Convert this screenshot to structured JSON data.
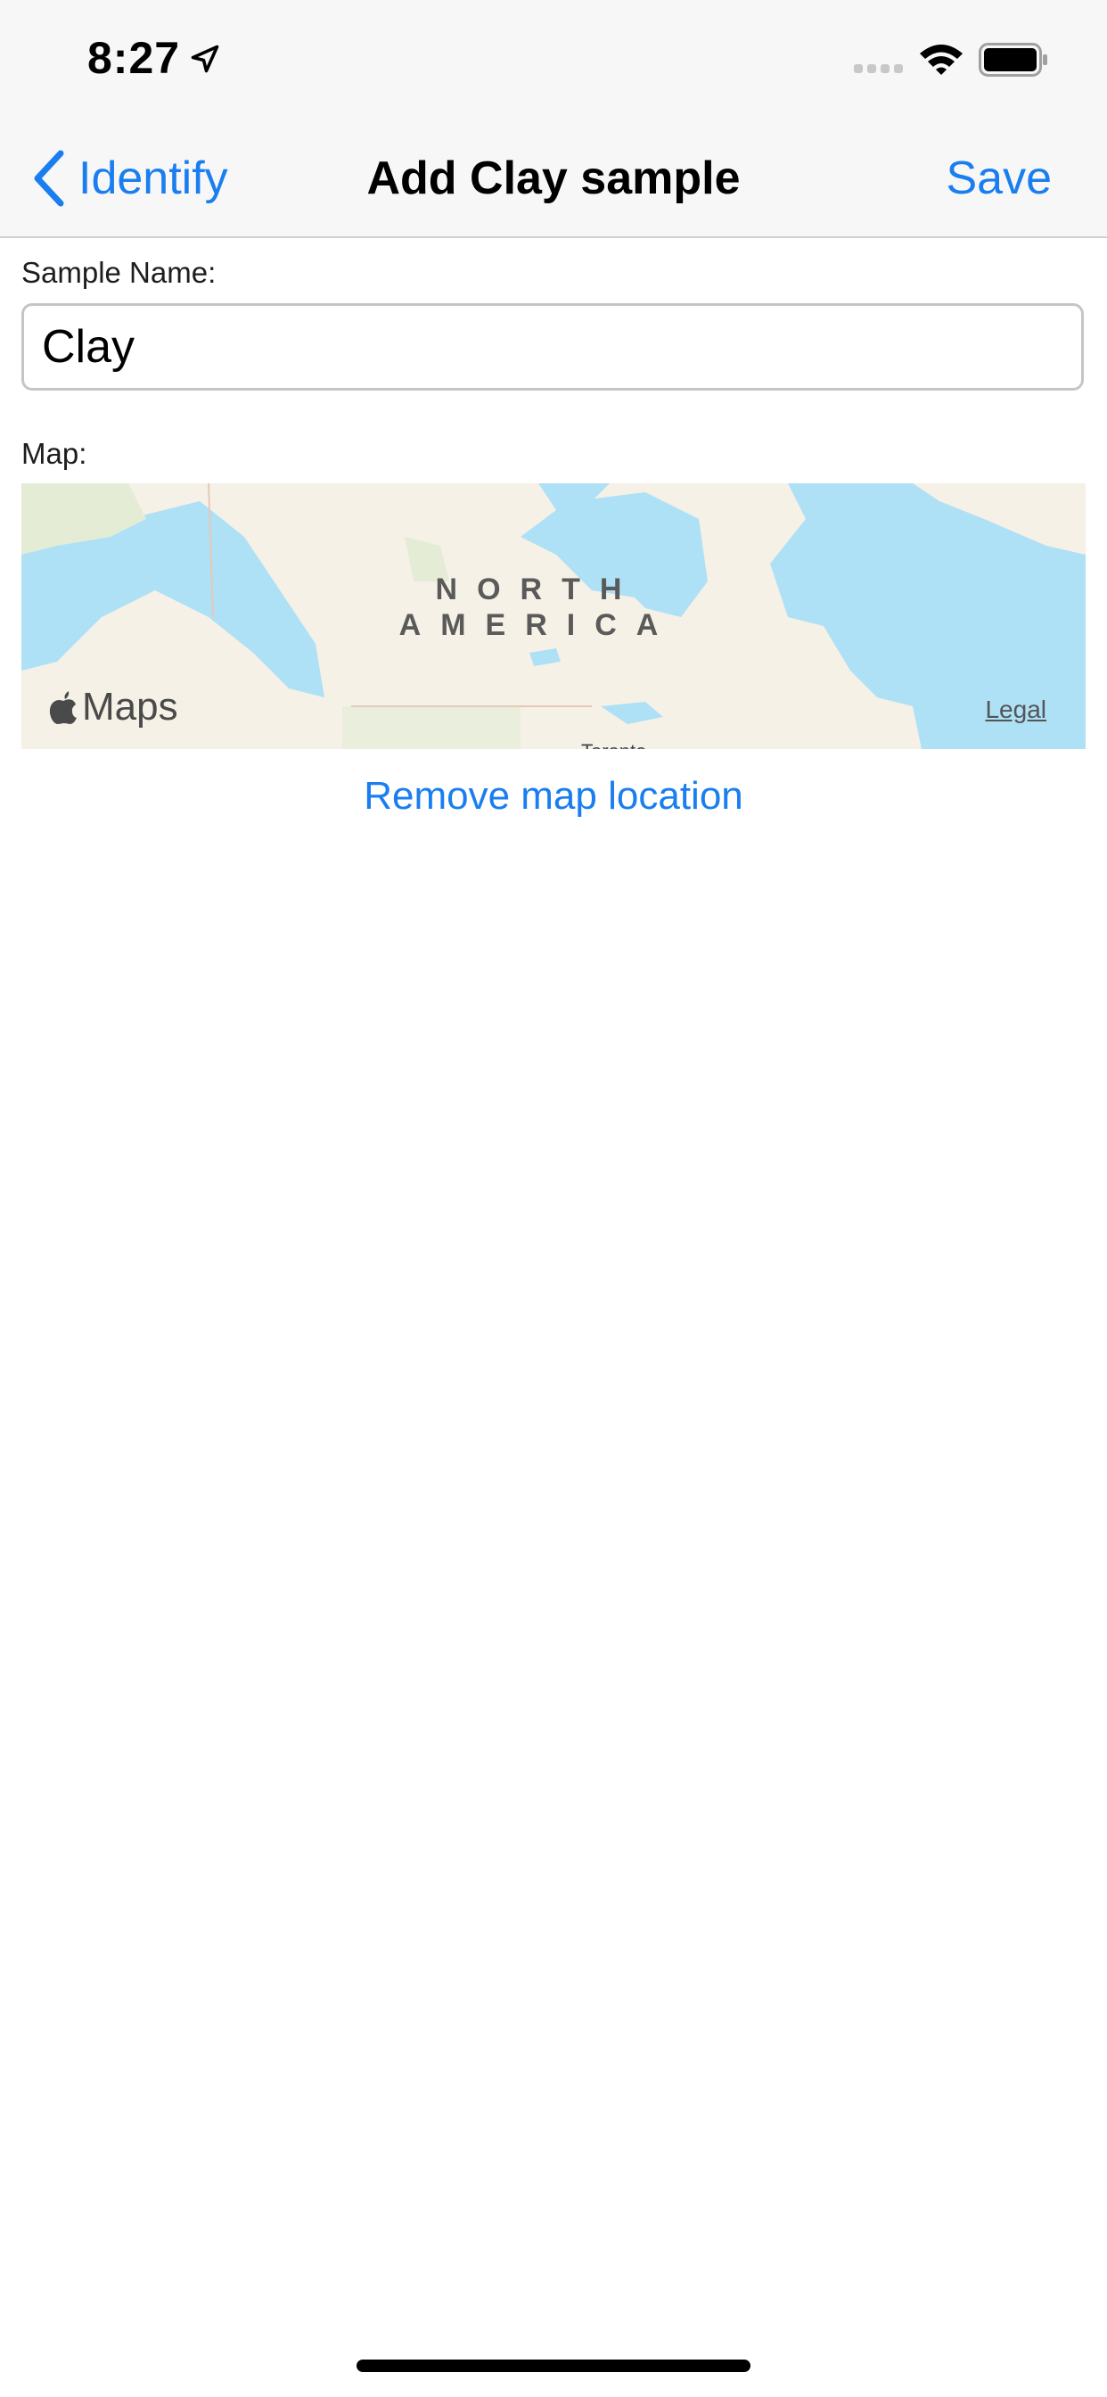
{
  "status_bar": {
    "time": "8:27"
  },
  "nav": {
    "back_label": "Identify",
    "title": "Add Clay sample",
    "save_label": "Save"
  },
  "form": {
    "sample_name_label": "Sample Name:",
    "sample_name_value": "Clay",
    "map_label": "Map:"
  },
  "map": {
    "region_label_line1": "NORTH",
    "region_label_line2": "AMERICA",
    "brand": "Maps",
    "legal": "Legal",
    "city": "Toronto"
  },
  "actions": {
    "remove_map_location": "Remove map location"
  },
  "colors": {
    "accent": "#1a7ef0",
    "water": "#aee0f6",
    "land": "#f5f1e6"
  }
}
